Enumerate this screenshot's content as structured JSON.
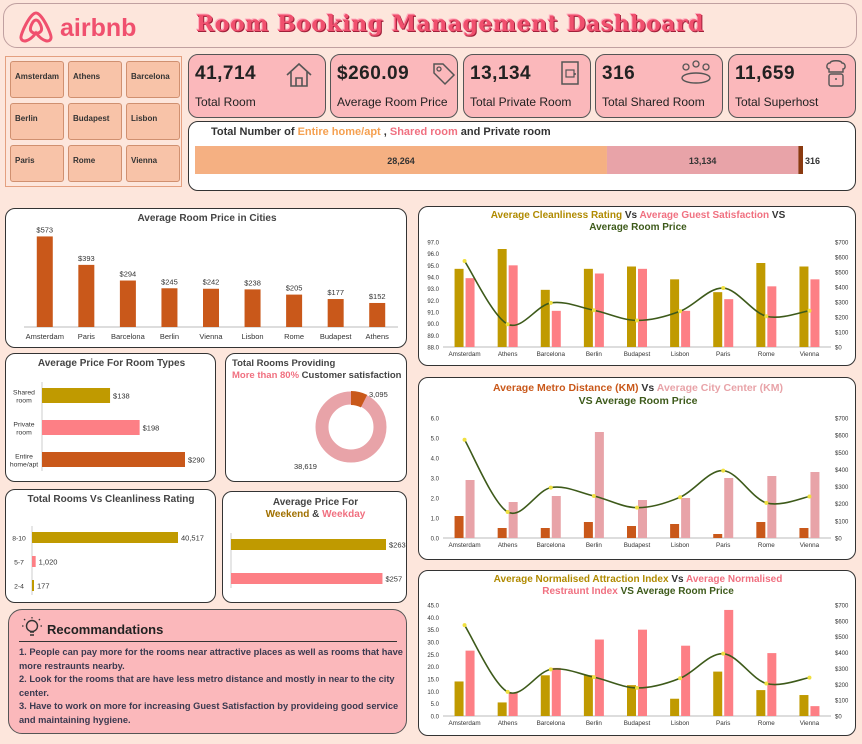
{
  "header": {
    "brand": "airbnb",
    "title": "Room Booking Management Dashboard"
  },
  "slicer": {
    "cities": [
      "Amsterdam",
      "Athens",
      "Barcelona",
      "Berlin",
      "Budapest",
      "Lisbon",
      "Paris",
      "Rome",
      "Vienna"
    ]
  },
  "kpis": [
    {
      "value": "41,714",
      "label": "Total Room",
      "icon": "house-icon"
    },
    {
      "value": "$260.09",
      "label": "Average Room Price",
      "icon": "price-tag-icon"
    },
    {
      "value": "13,134",
      "label": "Total Private Room",
      "icon": "door-icon"
    },
    {
      "value": "316",
      "label": "Total Shared Room",
      "icon": "group-icon"
    },
    {
      "value": "11,659",
      "label": "Total Superhost",
      "icon": "chef-icon"
    }
  ],
  "colors": {
    "orange": "#c9581a",
    "gold": "#c09a00",
    "pink": "#fd7f85",
    "lightpink": "#e8a3a8",
    "peach": "#f5b082",
    "line": "#3d5a1a",
    "dot": "#f0e040"
  },
  "total_rooms": {
    "title_parts": [
      "Total Number of ",
      "Entire home/apt",
      " , ",
      "Shared room",
      " and ",
      "Private  room"
    ],
    "segments": [
      {
        "label": "28,264",
        "value": 28264
      },
      {
        "label": "13,134",
        "value": 13134
      },
      {
        "label": "316",
        "value": 316
      }
    ]
  },
  "recommendations": {
    "title": "Recommandations",
    "items": [
      "1. People can pay more for the rooms near attractive places as well as rooms that have more restraunts nearby.",
      "2. Look for the rooms that are have less metro distance and mostly in near to the city center.",
      "3. Have to work on more for increasing Guest Satisfaction by provideing good service and maintaining hygiene."
    ]
  },
  "chart_data": [
    {
      "id": "avg-price-cities",
      "type": "bar",
      "title": "Average Room Price in Cities",
      "categories": [
        "Amsterdam",
        "Paris",
        "Barcelona",
        "Berlin",
        "Vienna",
        "Lisbon",
        "Rome",
        "Budapest",
        "Athens"
      ],
      "values": [
        573,
        393,
        294,
        245,
        242,
        238,
        205,
        177,
        152
      ],
      "labels": [
        "$573",
        "$393",
        "$294",
        "$245",
        "$242",
        "$238",
        "$205",
        "$177",
        "$152"
      ],
      "ylim": [
        0,
        620
      ]
    },
    {
      "id": "price-room-types",
      "type": "bar",
      "title": "Average Price For Room Types",
      "categories": [
        "Shared room",
        "Private room",
        "Entire home/apt"
      ],
      "values": [
        138,
        198,
        290
      ],
      "labels": [
        "$138",
        "$198",
        "$290"
      ]
    },
    {
      "id": "customer-satisfaction",
      "type": "pie",
      "title_parts": [
        "Total Rooms Providing ",
        "More than 80%",
        " Customer satisfaction"
      ],
      "labels": [
        "3,095",
        "38,619"
      ],
      "values": [
        3095,
        38619
      ]
    },
    {
      "id": "rooms-cleanliness",
      "type": "bar",
      "title": "Total Rooms Vs Cleanliness Rating",
      "categories": [
        "8-10",
        "5-7",
        "2-4"
      ],
      "values": [
        40517,
        1020,
        177
      ],
      "labels": [
        "40,517",
        "1,020",
        "177"
      ]
    },
    {
      "id": "weekend-weekday",
      "type": "bar",
      "title_parts": [
        "Average Price For",
        "Weekend",
        " & ",
        "Weekday"
      ],
      "categories": [
        "Weekend",
        "Weekday"
      ],
      "values": [
        263,
        257
      ],
      "labels": [
        "$263",
        "$257"
      ]
    },
    {
      "id": "clean-satisfaction",
      "type": "bar",
      "title_parts": [
        "Average Cleanliness Rating",
        " Vs ",
        "Average Guest Satisfaction",
        " VS",
        "Average Room Price"
      ],
      "categories": [
        "Amsterdam",
        "Athens",
        "Barcelona",
        "Berlin",
        "Budapest",
        "Lisbon",
        "Paris",
        "Rome",
        "Vienna"
      ],
      "series": [
        {
          "name": "Average Cleanliness Rating",
          "values": [
            94.7,
            96.4,
            92.9,
            94.7,
            94.9,
            93.8,
            92.7,
            95.2,
            94.9
          ]
        },
        {
          "name": "Average Guest Satisfaction",
          "values": [
            93.9,
            95.0,
            91.1,
            94.3,
            94.7,
            91.1,
            92.1,
            93.2,
            93.8
          ]
        },
        {
          "name": "Average Room Price",
          "axis": "right",
          "values": [
            573,
            152,
            294,
            245,
            177,
            238,
            393,
            205,
            242
          ]
        }
      ],
      "ylim": [
        88.0,
        97.0
      ],
      "yticks": [
        "88.0",
        "89.0",
        "90.0",
        "91.0",
        "92.0",
        "93.0",
        "94.0",
        "95.0",
        "96.0",
        "97.0"
      ],
      "y2lim": [
        0,
        700
      ],
      "y2ticks": [
        "$0",
        "$100",
        "$200",
        "$300",
        "$400",
        "$500",
        "$600",
        "$700"
      ]
    },
    {
      "id": "metro-center",
      "type": "bar",
      "title_parts": [
        "Average Metro Distance (KM)",
        " Vs ",
        "Average City Center (KM)",
        "VS Average Room Price"
      ],
      "categories": [
        "Amsterdam",
        "Athens",
        "Barcelona",
        "Berlin",
        "Budapest",
        "Lisbon",
        "Paris",
        "Rome",
        "Vienna"
      ],
      "series": [
        {
          "name": "Average Metro Distance (KM)",
          "values": [
            1.1,
            0.5,
            0.5,
            0.8,
            0.6,
            0.7,
            0.2,
            0.8,
            0.5
          ]
        },
        {
          "name": "Average City Center (KM)",
          "values": [
            2.9,
            1.8,
            2.1,
            5.3,
            1.9,
            2.0,
            3.0,
            3.1,
            3.3
          ]
        },
        {
          "name": "Average Room Price",
          "axis": "right",
          "values": [
            573,
            152,
            294,
            245,
            177,
            238,
            393,
            205,
            242
          ]
        }
      ],
      "ylim": [
        0,
        6.0
      ],
      "yticks": [
        "0.0",
        "1.0",
        "2.0",
        "3.0",
        "4.0",
        "5.0",
        "6.0"
      ],
      "y2lim": [
        0,
        700
      ],
      "y2ticks": [
        "$0",
        "$100",
        "$200",
        "$300",
        "$400",
        "$500",
        "$600",
        "$700"
      ]
    },
    {
      "id": "attraction-restraunt",
      "type": "bar",
      "title_parts": [
        "Average Normalised Attraction Index",
        " Vs ",
        "Average Normalised",
        "Restraunt Index",
        " VS Average Room Price"
      ],
      "categories": [
        "Amsterdam",
        "Athens",
        "Barcelona",
        "Berlin",
        "Budapest",
        "Lisbon",
        "Paris",
        "Rome",
        "Vienna"
      ],
      "series": [
        {
          "name": "Average Normalised Attraction Index",
          "values": [
            14.0,
            5.5,
            16.5,
            16.5,
            12.5,
            7.0,
            18.0,
            10.5,
            8.5
          ]
        },
        {
          "name": "Average Normalised Restraunt Index",
          "values": [
            26.5,
            9.5,
            19.5,
            31.0,
            35.0,
            28.5,
            43.0,
            25.5,
            4.0
          ]
        },
        {
          "name": "Average Room Price",
          "axis": "right",
          "values": [
            573,
            152,
            294,
            245,
            177,
            238,
            393,
            205,
            242
          ]
        }
      ],
      "ylim": [
        0,
        45.0
      ],
      "yticks": [
        "0.0",
        "5.0",
        "10.0",
        "15.0",
        "20.0",
        "25.0",
        "30.0",
        "35.0",
        "40.0",
        "45.0"
      ],
      "y2lim": [
        0,
        700
      ],
      "y2ticks": [
        "$0",
        "$100",
        "$200",
        "$300",
        "$400",
        "$500",
        "$600",
        "$700"
      ]
    }
  ]
}
